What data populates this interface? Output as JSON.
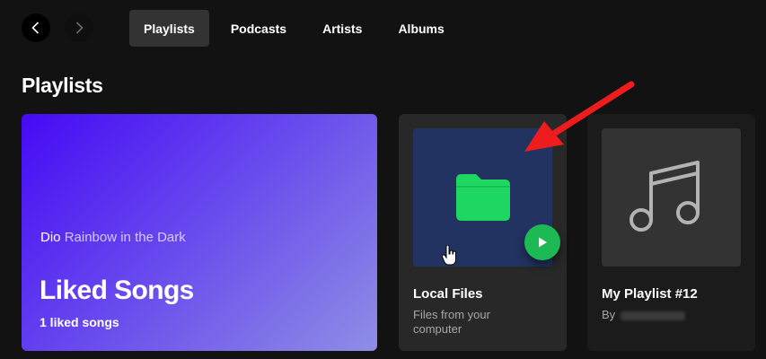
{
  "nav": {
    "back_icon": "chevron-left-icon",
    "forward_icon": "chevron-right-icon"
  },
  "tabs": [
    {
      "label": "Playlists",
      "active": true
    },
    {
      "label": "Podcasts",
      "active": false
    },
    {
      "label": "Artists",
      "active": false
    },
    {
      "label": "Albums",
      "active": false
    }
  ],
  "section": {
    "title": "Playlists"
  },
  "liked": {
    "preview_artist": "Dio",
    "preview_song": "Rainbow in the Dark",
    "title": "Liked Songs",
    "count": "1 liked songs"
  },
  "local_files": {
    "title": "Local Files",
    "subtitle": "Files from your computer",
    "icon": "folder-icon"
  },
  "my_playlist": {
    "title": "My Playlist #12",
    "by_prefix": "By",
    "icon": "music-note-icon"
  },
  "colors": {
    "background": "#121212",
    "accent_green": "#1db954",
    "annotation_red": "#ee1c1c"
  }
}
